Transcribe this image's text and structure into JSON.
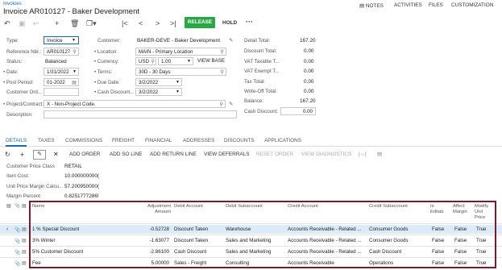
{
  "breadcrumb": "Invoices",
  "title": "Invoice AR010127 - Baker Development",
  "header_actions": [
    "NOTES",
    "ACTIVITIES",
    "FILES",
    "CUSTOMIZATION"
  ],
  "toolbar": {
    "release": "RELEASE",
    "hold": "HOLD",
    "more": "···"
  },
  "form": {
    "type_label": "Type:",
    "type_value": "Invoice",
    "refnbr_label": "Reference Nbr.:",
    "refnbr_value": "AR010127",
    "status_label": "Status:",
    "status_value": "Balanced",
    "date_label": "Date:",
    "date_value": "1/31/2022",
    "period_label": "Post Period:",
    "period_value": "01-2022",
    "custord_label": "Customer Ord...",
    "project_label": "Project/Contract:",
    "project_value": "X - Non-Project Code.",
    "desc_label": "Description:",
    "customer_label": "Customer:",
    "customer_value": "BAKER-DEVE - Baker Development",
    "location_label": "Location:",
    "location_value": "MAIN - Primary Location",
    "currency_label": "Currency:",
    "currency_value": "USD",
    "currency_rate": "1.00",
    "view_base": "VIEW BASE",
    "terms_label": "Terms:",
    "terms_value": "30D - 30 Days",
    "duedate_label": "Due Date:",
    "duedate_value": "3/2/2022",
    "cashdisc_label": "Cash Discount...",
    "cashdisc_value": "3/2/2022"
  },
  "totals": [
    {
      "label": "Detail Total:",
      "value": "167.20"
    },
    {
      "label": "Discount Total:",
      "value": "0.00"
    },
    {
      "label": "VAT Taxable T...",
      "value": "0.00"
    },
    {
      "label": "VAT Exempt T...",
      "value": "0.00"
    },
    {
      "label": "Tax Total:",
      "value": "0.00"
    },
    {
      "label": "Write-Off Total:",
      "value": "0.00"
    },
    {
      "label": "Balance:",
      "value": "167.20"
    },
    {
      "label": "Cash Discount:",
      "value": "0.00"
    }
  ],
  "tabs": [
    "DETAILS",
    "TAXES",
    "COMMISSIONS",
    "FREIGHT",
    "FINANCIAL",
    "ADDRESSES",
    "DISCOUNTS",
    "APPLICATIONS"
  ],
  "grid_toolbar": [
    "ADD ORDER",
    "ADD SO LINE",
    "ADD RETURN LINE",
    "VIEW DEFERRALS",
    "RESET ORDER",
    "VIEW DIAGNOSTICS"
  ],
  "info": [
    {
      "label": "Customer Price Class",
      "value": "RETAIL"
    },
    {
      "label": "Item Cost:",
      "value": "10.000000000("
    },
    {
      "label": "Unit Price Margin Calcu...",
      "value": "57.200950000("
    },
    {
      "label": "Margin Percent",
      "value": "0.8251777286!"
    }
  ],
  "columns": [
    "Name",
    "Adjustment Amount",
    "Debit Account",
    "Debit Subaccount",
    "Credit Account",
    "Credit Subaccount",
    "Is Editab",
    "Affect Margin",
    "Modify Unit Price"
  ],
  "rows": [
    [
      "1 % Special Discount",
      "-0.52728",
      "Discount Taken",
      "Warehouse",
      "Accounts Receivable - Related ...",
      "Consumer Goods",
      "False",
      "False",
      "True"
    ],
    [
      "3% Winter",
      "-1.63077",
      "Discount Taken",
      "Sales and Marketing",
      "Accounts Receivable - Related ...",
      "Consumer Goods",
      "False",
      "False",
      "True"
    ],
    [
      "5% Customer Discount",
      "-2.86100",
      "Cash Discount",
      "Sales and Marketing",
      "Accounts Receivable - Related ...",
      "Cash Discount",
      "False",
      "False",
      "True"
    ],
    [
      "Fee",
      "5.00000",
      "Sales - Freight",
      "Consulting",
      "Accounts Receivable",
      "Operations",
      "False",
      "False",
      "True"
    ]
  ]
}
